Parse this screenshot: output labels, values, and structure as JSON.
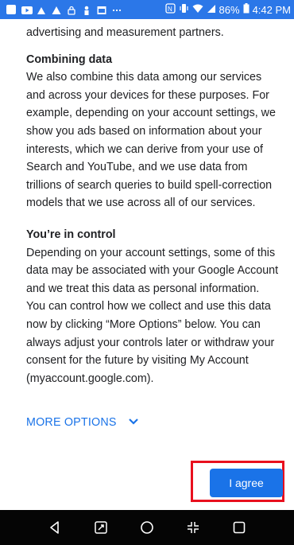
{
  "status_bar": {
    "battery": "86%",
    "time": "4:42 PM"
  },
  "content": {
    "intro_tail": "advertising and measurement partners.",
    "combining": {
      "heading": "Combining data",
      "body": "We also combine this data among our services and across your devices for these purposes. For example, depending on your account settings, we show you ads based on information about your interests, which we can derive from your use of Search and YouTube, and we use data from trillions of search queries to build spell-correction models that we use across all of our services."
    },
    "control": {
      "heading": "You’re in control",
      "body": "Depending on your account settings, some of this data may be associated with your Google Account and we treat this data as personal information. You can control how we collect and use this data now by clicking “More Options” below. You can always adjust your controls later or withdraw your consent for the future by visiting My Account (myaccount.google.com)."
    }
  },
  "actions": {
    "more_options_label": "MORE OPTIONS",
    "agree_label": "I agree"
  },
  "icons": {
    "status_left": [
      "calendar-icon",
      "youtube-icon",
      "app-icon",
      "alert-icon",
      "lock-icon",
      "person-icon",
      "image-icon",
      "more-icon"
    ],
    "status_right": [
      "nfc-icon",
      "vibrate-icon",
      "wifi-icon",
      "signal-icon",
      "battery-icon"
    ],
    "nav": [
      "back-icon",
      "rotate-icon",
      "home-icon",
      "split-screen-icon",
      "recents-icon"
    ]
  },
  "colors": {
    "status_bar": "#2b77e8",
    "accent": "#1a73e8",
    "highlight": "#e8101e",
    "nav_bar": "#050505"
  }
}
